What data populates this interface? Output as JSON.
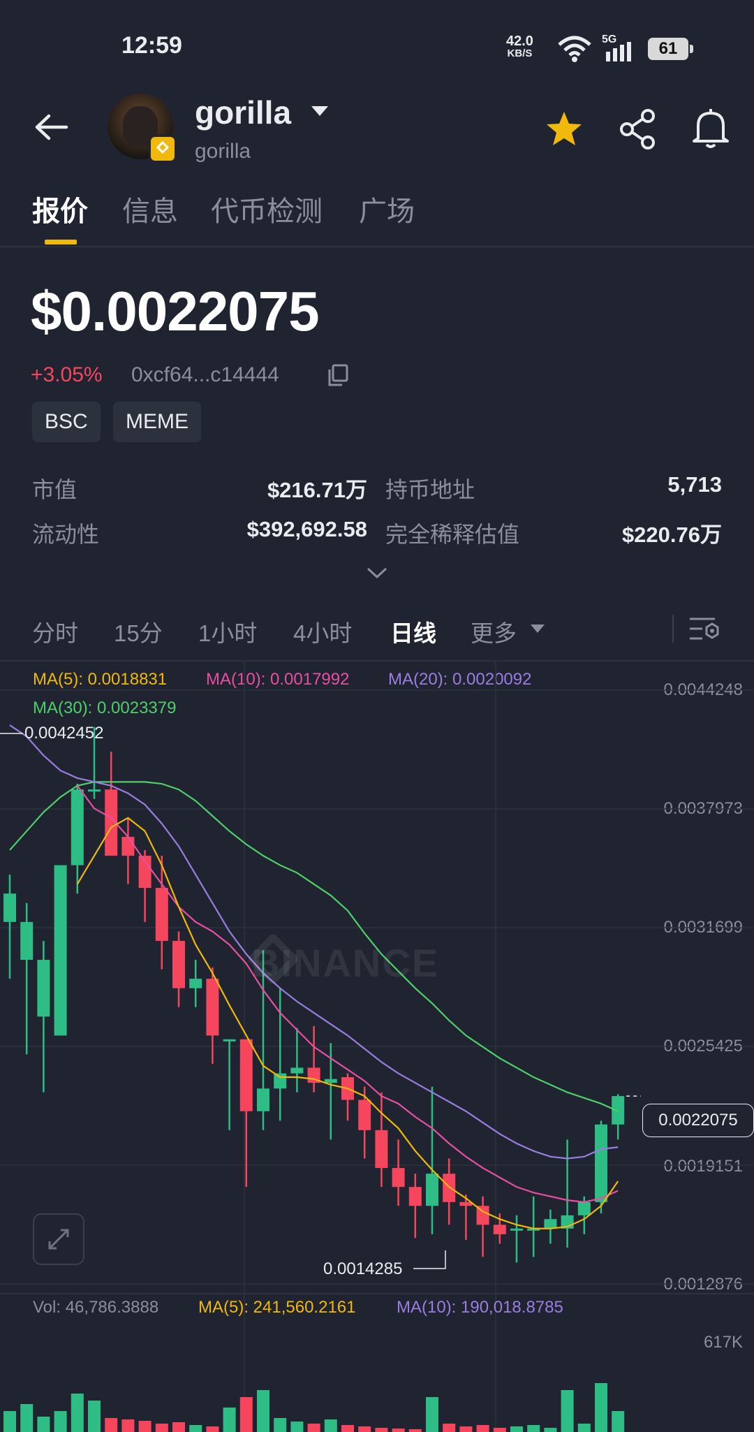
{
  "status_bar": {
    "time": "12:59",
    "net_speed": "42.0",
    "net_unit": "KB/S",
    "network": "5G",
    "battery": "61"
  },
  "header": {
    "token_name": "gorilla",
    "token_sub": "gorilla"
  },
  "tabs": [
    "报价",
    "信息",
    "代币检测",
    "广场"
  ],
  "price": {
    "value": "$0.0022075",
    "change": "+3.05%",
    "address": "0xcf64...c14444"
  },
  "tags": [
    "BSC",
    "MEME"
  ],
  "stats": {
    "market_cap_label": "市值",
    "market_cap": "$216.71万",
    "holders_label": "持币地址",
    "holders": "5,713",
    "liquidity_label": "流动性",
    "liquidity": "$392,692.58",
    "fdv_label": "完全稀释估值",
    "fdv": "$220.76万"
  },
  "intervals": [
    "分时",
    "15分",
    "1小时",
    "4小时",
    "日线",
    "更多"
  ],
  "ma_legend": {
    "ma5": "MA(5): 0.0018831",
    "ma10": "MA(10): 0.0017992",
    "ma20": "MA(20): 0.0020092",
    "ma30": "MA(30): 0.0023379"
  },
  "price_ticks": [
    "0.0044248",
    "0.0037973",
    "0.0031699",
    "0.0025425",
    "0.0019151",
    "0.0012876"
  ],
  "chart_labels": {
    "high": "0.0042452",
    "low": "0.0014285",
    "last": "0.0022075"
  },
  "watermark": "BINANCE",
  "volume": {
    "vol": "Vol: 46,786.3888",
    "ma5": "MA(5): 241,560.2161",
    "ma10": "MA(10): 190,018.8785",
    "max": "617K"
  },
  "colors": {
    "up": "#2ebd85",
    "down": "#f6465d",
    "accent": "#f0b90b",
    "ma5": "#f0b90b",
    "ma10": "#e84fa4",
    "ma20": "#9b7de0",
    "ma30": "#4fcf6b"
  },
  "chart_data": {
    "type": "candlestick",
    "interval": "日线",
    "ylim": [
      0.0012876,
      0.0044248
    ],
    "y_ticks": [
      0.0044248,
      0.0037973,
      0.0031699,
      0.0025425,
      0.0019151,
      0.0012876
    ],
    "candles": [
      {
        "o": 0.0032,
        "h": 0.00345,
        "l": 0.0029,
        "c": 0.00335
      },
      {
        "o": 0.003,
        "h": 0.0033,
        "l": 0.0025,
        "c": 0.0032
      },
      {
        "o": 0.0027,
        "h": 0.0031,
        "l": 0.0023,
        "c": 0.003
      },
      {
        "o": 0.0026,
        "h": 0.0035,
        "l": 0.0026,
        "c": 0.0035
      },
      {
        "o": 0.0035,
        "h": 0.00393,
        "l": 0.00335,
        "c": 0.0039
      },
      {
        "o": 0.0039,
        "h": 0.00423,
        "l": 0.00385,
        "c": 0.0039
      },
      {
        "o": 0.0039,
        "h": 0.0041,
        "l": 0.00365,
        "c": 0.00355
      },
      {
        "o": 0.00365,
        "h": 0.00375,
        "l": 0.0034,
        "c": 0.00355
      },
      {
        "o": 0.00355,
        "h": 0.00358,
        "l": 0.0032,
        "c": 0.00338
      },
      {
        "o": 0.00338,
        "h": 0.00355,
        "l": 0.00295,
        "c": 0.0031
      },
      {
        "o": 0.0031,
        "h": 0.00315,
        "l": 0.00275,
        "c": 0.00285
      },
      {
        "o": 0.00285,
        "h": 0.003,
        "l": 0.00275,
        "c": 0.0029
      },
      {
        "o": 0.0029,
        "h": 0.00296,
        "l": 0.00245,
        "c": 0.0026
      },
      {
        "o": 0.00258,
        "h": 0.00258,
        "l": 0.0021,
        "c": 0.00258
      },
      {
        "o": 0.00258,
        "h": 0.00258,
        "l": 0.0018,
        "c": 0.0022
      },
      {
        "o": 0.0022,
        "h": 0.00305,
        "l": 0.0021,
        "c": 0.00232
      },
      {
        "o": 0.00232,
        "h": 0.00285,
        "l": 0.00215,
        "c": 0.0024
      },
      {
        "o": 0.0024,
        "h": 0.00264,
        "l": 0.0023,
        "c": 0.00243
      },
      {
        "o": 0.00243,
        "h": 0.00265,
        "l": 0.0023,
        "c": 0.00235
      },
      {
        "o": 0.00235,
        "h": 0.00256,
        "l": 0.00205,
        "c": 0.00237
      },
      {
        "o": 0.00238,
        "h": 0.0024,
        "l": 0.00215,
        "c": 0.00226
      },
      {
        "o": 0.00226,
        "h": 0.00233,
        "l": 0.00195,
        "c": 0.0021
      },
      {
        "o": 0.0021,
        "h": 0.0023,
        "l": 0.0018,
        "c": 0.0019
      },
      {
        "o": 0.0019,
        "h": 0.00205,
        "l": 0.0017,
        "c": 0.0018
      },
      {
        "o": 0.0018,
        "h": 0.00187,
        "l": 0.00153,
        "c": 0.0017
      },
      {
        "o": 0.0017,
        "h": 0.00233,
        "l": 0.00155,
        "c": 0.00187
      },
      {
        "o": 0.00187,
        "h": 0.00195,
        "l": 0.0016,
        "c": 0.00172
      },
      {
        "o": 0.00172,
        "h": 0.00176,
        "l": 0.00152,
        "c": 0.0017
      },
      {
        "o": 0.0017,
        "h": 0.00175,
        "l": 0.00143,
        "c": 0.0016
      },
      {
        "o": 0.0016,
        "h": 0.00166,
        "l": 0.0015,
        "c": 0.00155
      },
      {
        "o": 0.00158,
        "h": 0.00165,
        "l": 0.0014,
        "c": 0.00158
      },
      {
        "o": 0.00158,
        "h": 0.00175,
        "l": 0.00143,
        "c": 0.00158
      },
      {
        "o": 0.00158,
        "h": 0.00168,
        "l": 0.0015,
        "c": 0.00163
      },
      {
        "o": 0.00158,
        "h": 0.00205,
        "l": 0.00148,
        "c": 0.00165
      },
      {
        "o": 0.00165,
        "h": 0.00175,
        "l": 0.00155,
        "c": 0.00172
      },
      {
        "o": 0.00172,
        "h": 0.00215,
        "l": 0.00166,
        "c": 0.00213
      },
      {
        "o": 0.00213,
        "h": 0.00229,
        "l": 0.00205,
        "c": 0.00228
      }
    ],
    "ma5": [
      null,
      null,
      null,
      null,
      0.0034,
      0.00355,
      0.0037,
      0.00375,
      0.00368,
      0.0035,
      0.00328,
      0.00308,
      0.00293,
      0.00276,
      0.0026,
      0.00244,
      0.00238,
      0.00238,
      0.00237,
      0.00234,
      0.00232,
      0.00228,
      0.00219,
      0.00211,
      0.00199,
      0.00189,
      0.0018,
      0.00174,
      0.00167,
      0.00163,
      0.0016,
      0.00158,
      0.00158,
      0.00159,
      0.00163,
      0.0017,
      0.00183
    ],
    "ma10": [
      null,
      null,
      null,
      null,
      0.00392,
      0.0038,
      0.00375,
      0.00365,
      0.00352,
      0.0034,
      0.00328,
      0.0032,
      0.00315,
      0.00308,
      0.00298,
      0.00284,
      0.00272,
      0.00263,
      0.00254,
      0.00248,
      0.00242,
      0.00236,
      0.00228,
      0.00224,
      0.00217,
      0.00211,
      0.00203,
      0.00196,
      0.0019,
      0.00185,
      0.0018,
      0.00177,
      0.00175,
      0.00173,
      0.00172,
      0.00174,
      0.00178
    ],
    "ma20": [
      0.00424,
      0.00418,
      0.00408,
      0.004,
      0.00396,
      0.00394,
      0.00392,
      0.00388,
      0.00382,
      0.00372,
      0.0036,
      0.00345,
      0.0033,
      0.00315,
      0.00303,
      0.00293,
      0.00285,
      0.00278,
      0.00272,
      0.00266,
      0.0026,
      0.00253,
      0.00246,
      0.0024,
      0.00235,
      0.0023,
      0.00225,
      0.0022,
      0.00214,
      0.00208,
      0.00203,
      0.00199,
      0.00196,
      0.00195,
      0.00196,
      0.002,
      0.00201
    ],
    "ma30": [
      0.00358,
      0.00368,
      0.00378,
      0.00386,
      0.00392,
      0.00394,
      0.00394,
      0.00394,
      0.00394,
      0.00393,
      0.0039,
      0.00384,
      0.00376,
      0.00368,
      0.00361,
      0.00355,
      0.0035,
      0.00346,
      0.0034,
      0.00334,
      0.00326,
      0.00314,
      0.00303,
      0.00294,
      0.00285,
      0.00277,
      0.00268,
      0.0026,
      0.00254,
      0.00248,
      0.00243,
      0.00238,
      0.00234,
      0.0023,
      0.00227,
      0.00224,
      0.0022
    ]
  }
}
